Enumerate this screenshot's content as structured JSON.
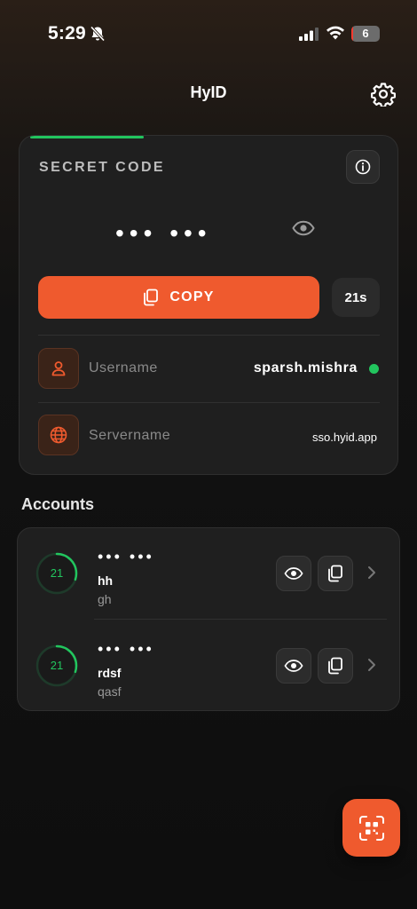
{
  "status_bar": {
    "time": "5:29",
    "battery_level": "6",
    "battery_fraction": 0.06
  },
  "header": {
    "title": "HyID"
  },
  "secret": {
    "label": "SECRET CODE",
    "code_masked": "••• •••",
    "copy_label": "COPY",
    "timer": "21s",
    "progress_fraction": 0.3,
    "username_label": "Username",
    "username_value": "sparsh.mishra",
    "servername_label": "Servername",
    "servername_value": "sso.hyid.app"
  },
  "accounts": {
    "title": "Accounts",
    "items": [
      {
        "code_masked": "••• •••",
        "name": "hh",
        "sub": "gh",
        "countdown": "21",
        "ring_fraction": 0.3
      },
      {
        "code_masked": "••• •••",
        "name": "rdsf",
        "sub": "qasf",
        "countdown": "21",
        "ring_fraction": 0.3
      }
    ]
  },
  "colors": {
    "accent": "#ef5a2e",
    "success": "#22c55e",
    "card": "#1f1f1f"
  },
  "icons": {
    "settings": "gear-icon",
    "info": "info-icon",
    "reveal": "eye-icon",
    "copy": "copy-icon",
    "user": "user-icon",
    "server": "globe-icon",
    "chevron": "chevron-right-icon",
    "scan": "qr-scan-icon"
  }
}
